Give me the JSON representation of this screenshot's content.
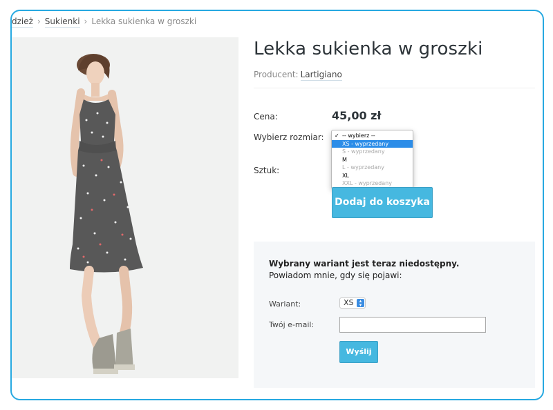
{
  "breadcrumb": {
    "items": [
      "dzież",
      "Sukienki"
    ],
    "separator": "›",
    "current": "Lekka sukienka w groszki"
  },
  "product": {
    "title": "Lekka sukienka w groszki",
    "producer_label": "Producent:",
    "producer": "Lartigiano",
    "price_label": "Cena:",
    "price": "45,00 zł",
    "size_label": "Wybierz rozmiar:",
    "quantity_label": "Sztuk:",
    "size_options": [
      {
        "label": "-- wybierz --",
        "checked": true,
        "disabled": false,
        "highlighted": false
      },
      {
        "label": "XS - wyprzedany",
        "checked": false,
        "disabled": false,
        "highlighted": true
      },
      {
        "label": "S - wyprzedany",
        "checked": false,
        "disabled": true,
        "highlighted": false
      },
      {
        "label": "M",
        "checked": false,
        "disabled": false,
        "highlighted": false
      },
      {
        "label": "L - wyprzedany",
        "checked": false,
        "disabled": true,
        "highlighted": false
      },
      {
        "label": "XL",
        "checked": false,
        "disabled": false,
        "highlighted": false
      },
      {
        "label": "XXL - wyprzedany",
        "checked": false,
        "disabled": true,
        "highlighted": false
      }
    ],
    "add_to_cart_label": "Dodaj do koszyka"
  },
  "notify": {
    "message_bold": "Wybrany wariant jest teraz niedostępny.",
    "message": "Powiadom mnie, gdy się pojawi:",
    "variant_label": "Wariant:",
    "variant_value": "XS",
    "email_label": "Twój e-mail:",
    "email_value": "",
    "submit_label": "Wyślij"
  },
  "colors": {
    "accent": "#46b8e0",
    "frame_border": "#27a9e1",
    "dress": "#585858",
    "highlight": "#2c8de8"
  },
  "icons": {
    "checkmark": "checkmark-icon",
    "select_arrows": "up-down-arrows-icon"
  }
}
